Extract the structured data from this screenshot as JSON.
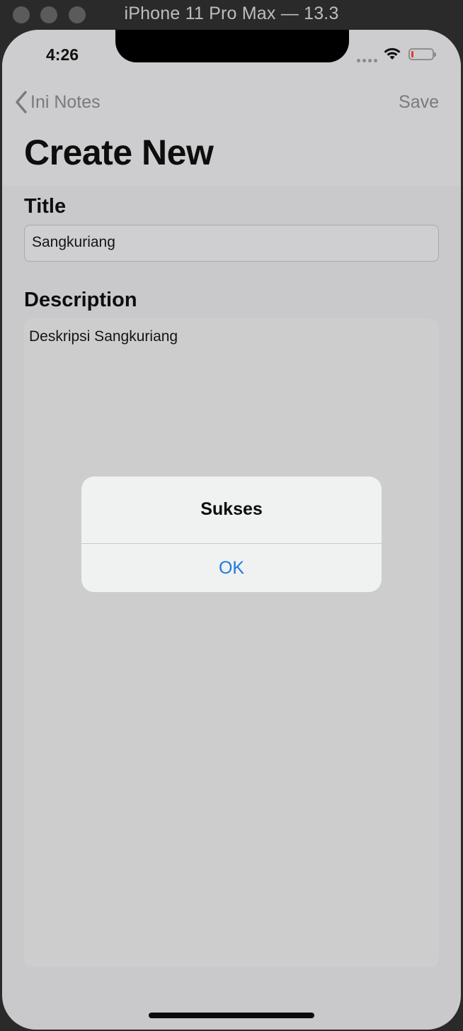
{
  "window": {
    "title": "iPhone 11 Pro Max — 13.3"
  },
  "status_bar": {
    "time": "4:26",
    "battery_color": "#e53b30"
  },
  "nav": {
    "back_label": "Ini Notes",
    "save_label": "Save",
    "large_title": "Create New"
  },
  "form": {
    "title_label": "Title",
    "title_value": "Sangkuriang",
    "description_label": "Description",
    "description_value": "Deskripsi Sangkuriang"
  },
  "alert": {
    "title": "Sukses",
    "ok_label": "OK",
    "accent": "#1d7bdc"
  },
  "icons": {
    "back": "chevron-left-icon",
    "wifi": "wifi-icon",
    "battery": "battery-icon",
    "signal": "cellular-signal-icon"
  }
}
